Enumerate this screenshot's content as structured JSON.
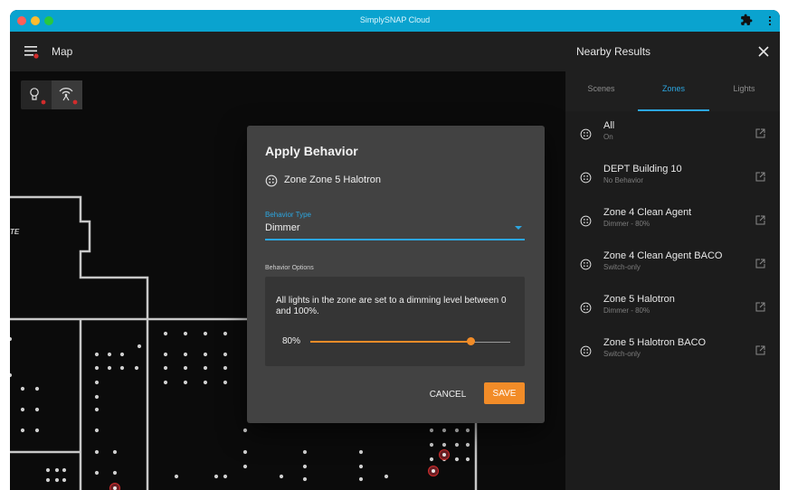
{
  "window": {
    "title": "SimplySNAP Cloud"
  },
  "appbar": {
    "title": "Map"
  },
  "dialog": {
    "title": "Apply Behavior",
    "zone_label": "Zone Zone 5 Halotron",
    "behavior_type_label": "Behavior Type",
    "behavior_type_value": "Dimmer",
    "options_label": "Behavior Options",
    "options_description": "All lights in the zone are set to a dimming level between 0 and 100%.",
    "slider_value_label": "80%",
    "slider_level": 80,
    "cancel_label": "CANCEL",
    "save_label": "SAVE"
  },
  "side_panel": {
    "title": "Nearby Results",
    "tabs": [
      {
        "label": "Scenes",
        "active": false
      },
      {
        "label": "Zones",
        "active": true
      },
      {
        "label": "Lights",
        "active": false
      }
    ],
    "zones": [
      {
        "name": "All",
        "status": "On"
      },
      {
        "name": "DEPT Building 10",
        "status": "No Behavior"
      },
      {
        "name": "Zone 4 Clean Agent",
        "status": "Dimmer - 80%"
      },
      {
        "name": "Zone 4 Clean Agent BACO",
        "status": "Switch-only"
      },
      {
        "name": "Zone 5 Halotron",
        "status": "Dimmer - 80%"
      },
      {
        "name": "Zone 5 Halotron BACO",
        "status": "Switch-only"
      }
    ]
  },
  "map": {
    "building_label": "TE"
  },
  "colors": {
    "accent": "#2ca6e0",
    "action": "#f28c28",
    "titlebar": "#0aa3cf",
    "alert_dot": "#d22c2c"
  },
  "icons": {
    "menu": "menu-icon",
    "close": "close-icon",
    "zone": "zone-icon",
    "open": "open-in-new-icon",
    "bulb": "lightbulb-icon",
    "antenna": "antenna-icon",
    "extension": "puzzle-icon",
    "more": "more-vert-icon"
  }
}
